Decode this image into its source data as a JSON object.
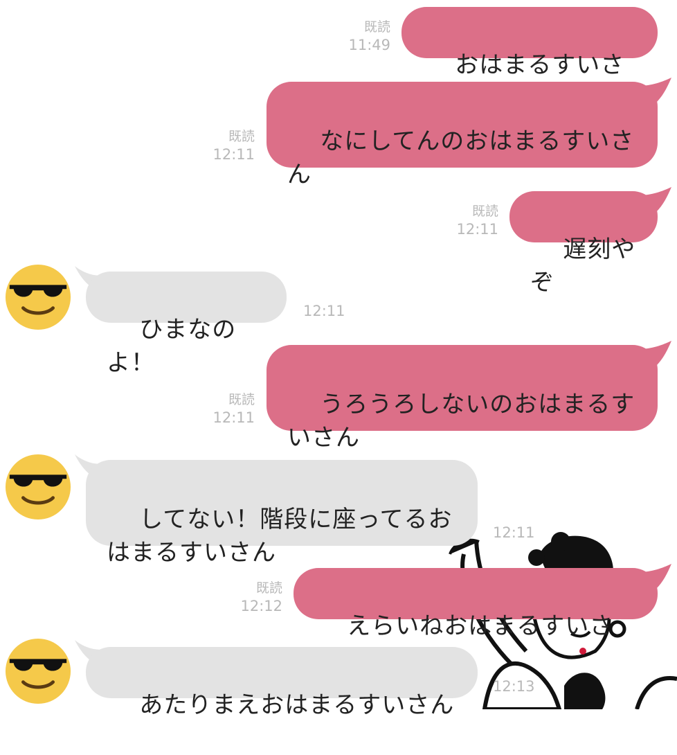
{
  "messages": [
    {
      "side": "out",
      "text": "おはまるすいさん",
      "read": "既読",
      "time": "11:49"
    },
    {
      "side": "out",
      "text": "なにしてんのおはまるすいさ\nん",
      "read": "既読",
      "time": "12:11"
    },
    {
      "side": "out",
      "text": "遅刻やぞ",
      "read": "既読",
      "time": "12:11"
    },
    {
      "side": "in",
      "text": "ひまなのよ！",
      "time": "12:11"
    },
    {
      "side": "out",
      "text": "うろうろしないのおはまるす\nいさん",
      "read": "既読",
      "time": "12:11"
    },
    {
      "side": "in",
      "text": "してない！階段に座ってるお\nはまるすいさん",
      "time": "12:11"
    },
    {
      "side": "out",
      "text": "えらいねおはまるすいさん",
      "read": "既読",
      "time": "12:12"
    },
    {
      "side": "in",
      "text": "あたりまえおはまるすいさん",
      "time": "12:13"
    }
  ],
  "avatar_icon": "sunglasses-smiley-icon",
  "colors": {
    "outgoing_bubble": "#dc6f88",
    "incoming_bubble": "#e3e3e3",
    "meta_text": "#b8b8b8",
    "avatar_face": "#f5c94a"
  }
}
